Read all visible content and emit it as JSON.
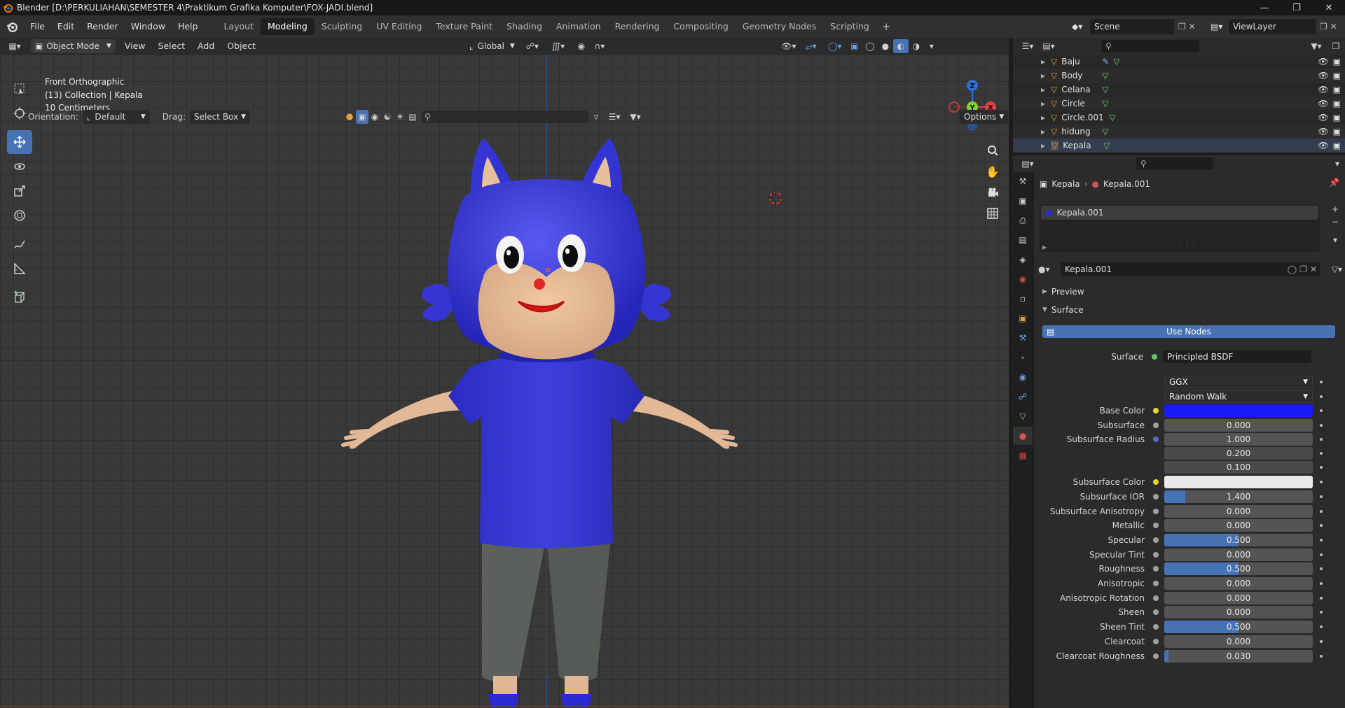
{
  "window": {
    "title": "Blender [D:\\PERKULIAHAN\\SEMESTER 4\\Praktikum Grafika Komputer\\FOX-JADI.blend]"
  },
  "menu": [
    "File",
    "Edit",
    "Render",
    "Window",
    "Help"
  ],
  "workspaces": [
    "Layout",
    "Modeling",
    "Sculpting",
    "UV Editing",
    "Texture Paint",
    "Shading",
    "Animation",
    "Rendering",
    "Compositing",
    "Geometry Nodes",
    "Scripting"
  ],
  "active_workspace": "Modeling",
  "scene": {
    "name": "Scene",
    "view_layer": "ViewLayer"
  },
  "viewport_header": {
    "mode": "Object Mode",
    "menus": [
      "View",
      "Select",
      "Add",
      "Object"
    ],
    "transform_orientation": "Global",
    "orientation_label": "Orientation:",
    "orientation_value": "Default",
    "drag_label": "Drag:",
    "drag_value": "Select Box",
    "options_label": "Options"
  },
  "viewport_info": {
    "view": "Front Orthographic",
    "collection": "(13) Collection | Kepala",
    "scale": "10 Centimeters"
  },
  "gizmo": {
    "x": "X",
    "y": "Y",
    "z": "Z"
  },
  "outliner": {
    "items": [
      {
        "name": "Baju"
      },
      {
        "name": "Body"
      },
      {
        "name": "Celana"
      },
      {
        "name": "Circle"
      },
      {
        "name": "Circle.001"
      },
      {
        "name": "hidung"
      },
      {
        "name": "Kepala"
      }
    ]
  },
  "properties": {
    "breadcrumb_object": "Kepala",
    "breadcrumb_material": "Kepala.001",
    "slot_name": "Kepala.001",
    "material_name": "Kepala.001",
    "panel_preview": "Preview",
    "panel_surface": "Surface",
    "use_nodes": "Use Nodes",
    "surface_label": "Surface",
    "surface_value": "Principled BSDF",
    "distribution": "GGX",
    "subsurface_method": "Random Walk",
    "rows": [
      {
        "label": "Base Color",
        "value": "",
        "fill": 0,
        "socket": "#e8d22c"
      },
      {
        "label": "Subsurface",
        "value": "0.000",
        "fill": 0,
        "socket": "#a0a0a0"
      },
      {
        "label": "Subsurface Radius",
        "value": "1.000",
        "fill": 0,
        "socket": "#6363c7"
      },
      {
        "label": "",
        "value": "0.200",
        "fill": 0,
        "socket": ""
      },
      {
        "label": "",
        "value": "0.100",
        "fill": 0,
        "socket": ""
      },
      {
        "label": "Subsurface Color",
        "value": "",
        "fill": 0,
        "socket": "#e8d22c"
      },
      {
        "label": "Subsurface IOR",
        "value": "1.400",
        "fill": 0.14,
        "socket": "#a0a0a0"
      },
      {
        "label": "Subsurface Anisotropy",
        "value": "0.000",
        "fill": 0,
        "socket": "#a0a0a0"
      },
      {
        "label": "Metallic",
        "value": "0.000",
        "fill": 0,
        "socket": "#a0a0a0"
      },
      {
        "label": "Specular",
        "value": "0.500",
        "fill": 0.5,
        "socket": "#a0a0a0"
      },
      {
        "label": "Specular Tint",
        "value": "0.000",
        "fill": 0,
        "socket": "#a0a0a0"
      },
      {
        "label": "Roughness",
        "value": "0.500",
        "fill": 0.5,
        "socket": "#a0a0a0"
      },
      {
        "label": "Anisotropic",
        "value": "0.000",
        "fill": 0,
        "socket": "#a0a0a0"
      },
      {
        "label": "Anisotropic Rotation",
        "value": "0.000",
        "fill": 0,
        "socket": "#a0a0a0"
      },
      {
        "label": "Sheen",
        "value": "0.000",
        "fill": 0,
        "socket": "#a0a0a0"
      },
      {
        "label": "Sheen Tint",
        "value": "0.500",
        "fill": 0.5,
        "socket": "#a0a0a0"
      },
      {
        "label": "Clearcoat",
        "value": "0.000",
        "fill": 0,
        "socket": "#a0a0a0"
      },
      {
        "label": "Clearcoat Roughness",
        "value": "0.030",
        "fill": 0.03,
        "socket": "#a0a0a0"
      }
    ],
    "base_color": "#1a1af5",
    "subsurface_color": "#eaeaea"
  },
  "colors": {
    "accent": "#4772b3",
    "character_blue": "#3a3ad8"
  }
}
